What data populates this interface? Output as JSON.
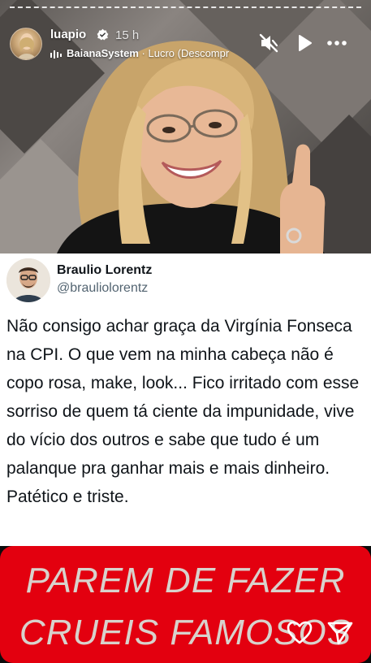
{
  "story": {
    "username": "luapio",
    "time": "15 h",
    "music_artist": "BaianaSystem",
    "music_separator": "·",
    "music_track": "Lucro (Descompr"
  },
  "tweet": {
    "name": "Braulio Lorentz",
    "handle": "@brauliolorentz",
    "text": "Não consigo achar graça da Virgínia Fonseca na CPI. O que vem na minha cabeça não é copo rosa, make, look... Fico irritado com esse sorriso de quem tá ciente da impunidade, vive do vício dos outros e sabe que tudo é um palanque pra ganhar mais e mais dinheiro. Patético e triste."
  },
  "overlay": {
    "line1": "PAREM DE FAZER",
    "line2": "CRUEIS FAMOSOS"
  },
  "icons": {
    "verified": "verified-badge-icon",
    "mute": "muted-speaker-icon",
    "play": "play-icon",
    "more": "more-dots-icon",
    "music": "music-bars-icon",
    "like": "heart-icon",
    "send": "send-paper-plane-icon"
  },
  "colors": {
    "overlay_box": "#e3000f",
    "overlay_text": "#d8d2cc",
    "tweet_name": "#0f1419",
    "tweet_handle": "#536471"
  }
}
